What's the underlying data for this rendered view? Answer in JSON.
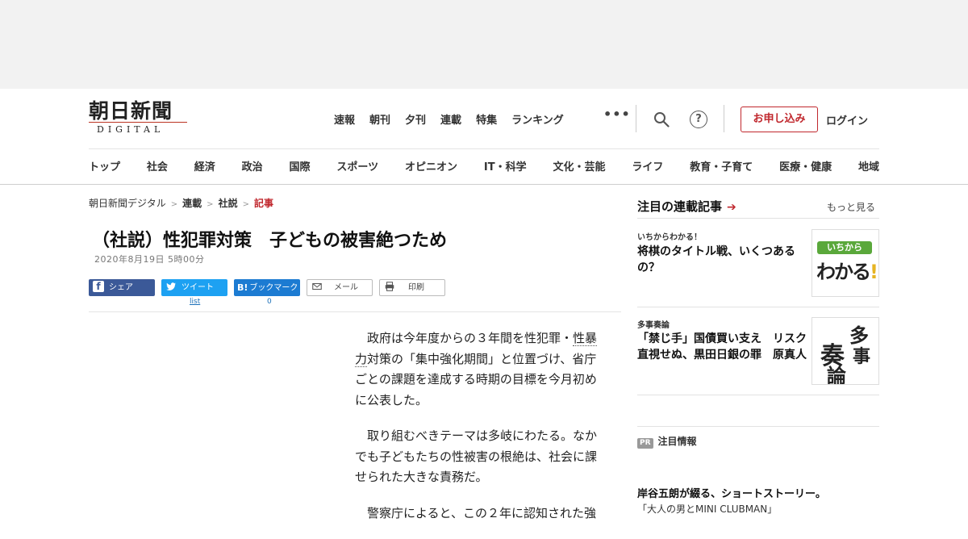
{
  "logo": {
    "main": "朝日新聞",
    "sub": "DIGITAL"
  },
  "topnav": [
    "速報",
    "朝刊",
    "夕刊",
    "連載",
    "特集",
    "ランキング"
  ],
  "more_dots": "•••",
  "help_glyph": "?",
  "apply_label": "お申し込み",
  "login_label": "ログイン",
  "catnav": [
    "トップ",
    "社会",
    "経済",
    "政治",
    "国際",
    "スポーツ",
    "オピニオン",
    "IT・科学",
    "文化・芸能",
    "ライフ",
    "教育・子育て",
    "医療・健康",
    "地域"
  ],
  "breadcrumb": [
    "朝日新聞デジタル",
    "連載",
    "社説",
    "記事"
  ],
  "breadcrumb_sep": ">",
  "article": {
    "title": "（社説）性犯罪対策　子どもの被害絶つため",
    "date": "2020年8月19日 5時00分",
    "p1_a": "政府は今年度からの３年間を性犯罪・",
    "p1_kw": "性暴力",
    "p1_b": "対策の「集中強化期間」と位置づけ、省庁ごとの課題を達成する時期の目標を今月初めに公表した。",
    "p2": "取り組むべきテーマは多岐にわたる。なかでも子どもたちの性被害の根絶は、社会に課せられた大きな責務だ。",
    "p3": "警察庁によると、この２年に認知された強"
  },
  "share": {
    "fb_icon": "f",
    "fb": "シェア",
    "tw": "ツイート",
    "tw_count": "list",
    "hb_icon": "B!",
    "hb": "ブックマーク",
    "hb_count": "0",
    "mail": "メール",
    "print": "印刷"
  },
  "sidebar": {
    "heading": "注目の連載記事",
    "arrow": "➔",
    "more": "もっと見る",
    "items": [
      {
        "kicker": "いちからわかる！",
        "title": "将棋のタイトル戦、いくつあるの？",
        "thumb_top": "いちから",
        "thumb_big": "わかる",
        "thumb_bang": "!"
      },
      {
        "kicker": "多事奏論",
        "title": "「禁じ手」国債買い支え　リスク直視せぬ、黒田日銀の罪　原真人",
        "thumb_chars": [
          "多",
          "奏",
          "事",
          "論"
        ]
      }
    ],
    "pr_badge": "PR",
    "pr_label": "注目情報",
    "pr_title": "岸谷五朗が綴る、ショートストーリー。",
    "pr_sub": "「大人の男とMINI CLUBMAN」"
  },
  "colors": {
    "accent": "#c0272d",
    "facebook": "#3b5998",
    "twitter": "#1da1f2",
    "hatena": "#1c7bd2"
  }
}
